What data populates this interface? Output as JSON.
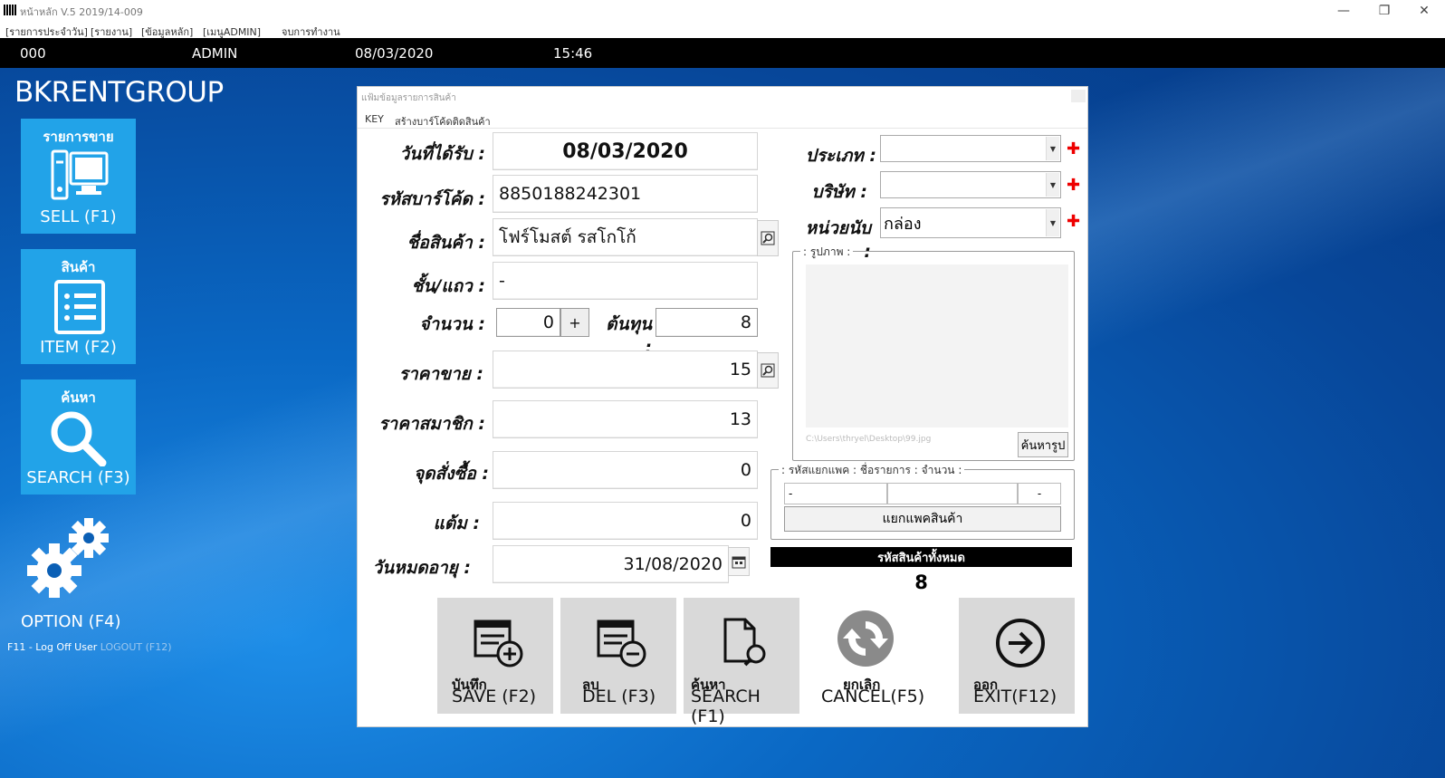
{
  "window": {
    "title": "หน้าหลัก V.5 2019/14-009",
    "minimize": "—",
    "restore": "❐",
    "close": "✕"
  },
  "menu": [
    "[รายการประจำวัน]",
    "[รายงาน]",
    "[ข้อมูลหลัก]",
    "[เมนูADMIN]",
    "จบการทำงาน"
  ],
  "status": {
    "code": "000",
    "user": "ADMIN",
    "date": "08/03/2020",
    "time": "15:46"
  },
  "brand": "BKRENTGROUP",
  "sidebar": {
    "sell": {
      "thai": "รายการขาย",
      "label": "SELL (F1)"
    },
    "item": {
      "thai": "สินค้า",
      "label": "ITEM (F2)"
    },
    "search": {
      "thai": "ค้นหา",
      "label": "SEARCH (F3)"
    },
    "option": {
      "label": "OPTION (F4)"
    },
    "logoff": "F11 - Log Off User",
    "logout": "LOGOUT (F12)"
  },
  "dialog": {
    "title": "แฟ้มข้อมูลรายการสินค้า",
    "menu": [
      "KEY",
      "สร้างบาร์โค้ดติดสินค้า"
    ],
    "labels": {
      "received": "วันที่ได้รับ :",
      "barcode": "รหัสบาร์โค้ด :",
      "name": "ชื่อสินค้า :",
      "shelf": "ชั้น/แถว :",
      "qty": "จำนวน :",
      "cost": "ต้นทุน :",
      "price": "ราคาขาย :",
      "member_price": "ราคาสมาชิก :",
      "reorder": "จุดสั่งซื้อ :",
      "points": "แต้ม :",
      "expiry": "วันหมดอายุ :",
      "type": "ประเภท :",
      "company": "บริษัท :",
      "unit": "หน่วยนับ :"
    },
    "values": {
      "received": "08/03/2020",
      "barcode": "8850188242301",
      "name": "โฟร์โมสต์ รสโกโก้",
      "shelf": "-",
      "qty": "0",
      "qty_plus": "+",
      "cost": "8",
      "price": "15",
      "member_price": "13",
      "reorder": "0",
      "points": "0",
      "expiry": "31/08/2020",
      "type": "",
      "company": "",
      "unit": "กล่อง"
    },
    "required_mark": "✚",
    "image_group": ": รูปภาพ :",
    "image_path": "C:\\Users\\thryel\\Desktop\\99.jpg",
    "find_image": "ค้นหารูป",
    "pack_group": ": รหัสแยกแพค : ชื่อรายการ : จำนวน :",
    "pack_fields": [
      "-",
      "",
      "-"
    ],
    "pack_button": "แยกแพคสินค้า",
    "total_label": "รหัสสินค้าทั้งหมด",
    "total_value": "8",
    "actions": {
      "save": {
        "thai": "บันทึก",
        "label": "SAVE (F2)"
      },
      "del": {
        "thai": "ลบ",
        "label": "DEL (F3)"
      },
      "search": {
        "thai": "ค้นหา",
        "label": "SEARCH (F1)"
      },
      "cancel": {
        "thai": "ยกเลิก",
        "label": "CANCEL(F5)"
      },
      "exit": {
        "thai": "ออก",
        "label": "EXIT(F12)"
      }
    }
  },
  "colors": {
    "tile": "#22a3e8",
    "desktop": "#0a5aa8",
    "required": "#e00000"
  }
}
